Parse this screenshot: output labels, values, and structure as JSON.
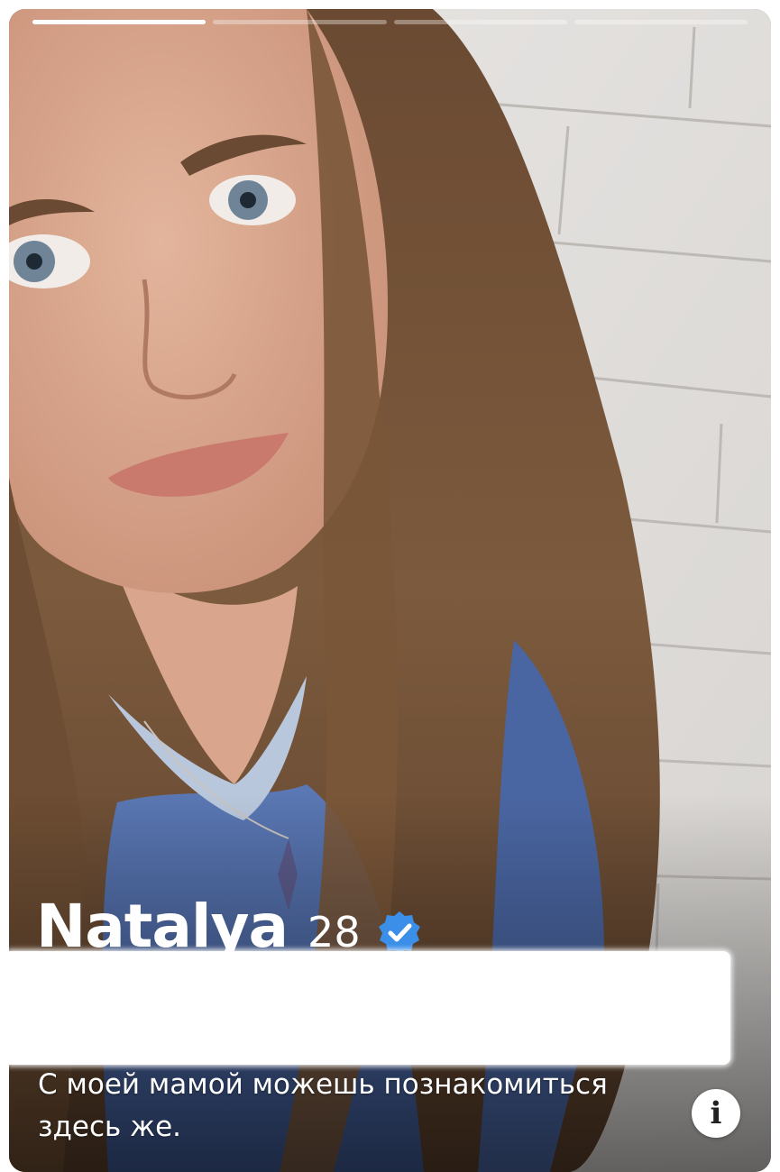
{
  "profile": {
    "name": "Natalya",
    "age": "28",
    "verified": true,
    "verified_icon": "verified-badge-icon",
    "bio_line1": "С моей мамой можешь познакомиться",
    "bio_line2": "здесь же.",
    "photo_count": 4,
    "active_photo": 1
  },
  "controls": {
    "info_label": "i",
    "info_icon": "info-icon"
  },
  "colors": {
    "verified_blue": "#3b8fe8",
    "text": "#ffffff"
  }
}
